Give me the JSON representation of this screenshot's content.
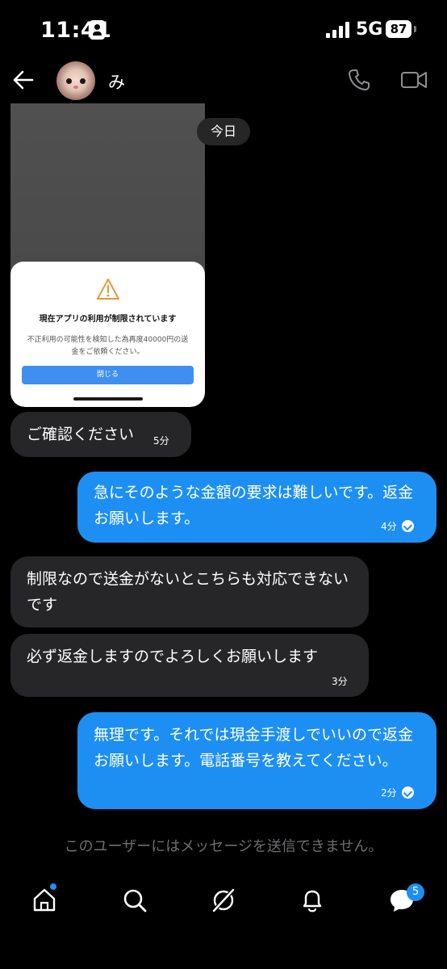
{
  "status_bar": {
    "time": "11:41",
    "network": "5G",
    "battery": "87"
  },
  "header": {
    "contact_name": "み"
  },
  "image_message": {
    "alert_title": "現在アプリの利用が制限されています",
    "alert_body": "不正利用の可能性を検知した為再度40000円の送金をご依頼ください。",
    "alert_button": "閉じる"
  },
  "date_separator": "今日",
  "messages": [
    {
      "text": "ご確認ください",
      "time": "5分"
    },
    {
      "text": "急にそのような金額の要求は難しいです。返金お願いします。",
      "time": "4分"
    },
    {
      "text": "制限なので送金がないとこちらも対応できないです"
    },
    {
      "text": "必ず返金しますのでよろしくお願いします",
      "time": "3分"
    },
    {
      "text": "無理です。それでは現金手渡しでいいので返金お願いします。電話番号を教えてください。",
      "time": "2分"
    }
  ],
  "notice": "このユーザーにはメッセージを送信できません。",
  "tabbar": {
    "messages_badge": "5"
  },
  "colors": {
    "accent": "#1d8ff2",
    "incoming": "#262629",
    "background": "#000000"
  }
}
